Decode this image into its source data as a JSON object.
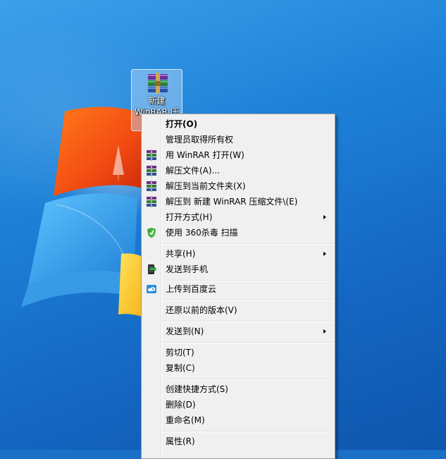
{
  "desktop_icon": {
    "label": "新建\nWinRAR 压",
    "icon": "winrar-archive-icon"
  },
  "context_menu": {
    "items": [
      {
        "label": "打开(O)",
        "bold": true,
        "icon": "",
        "submenu": false
      },
      {
        "label": "管理员取得所有权",
        "icon": "",
        "submenu": false
      },
      {
        "label": "用 WinRAR 打开(W)",
        "icon": "winrar-icon",
        "submenu": false
      },
      {
        "label": "解压文件(A)...",
        "icon": "winrar-icon",
        "submenu": false
      },
      {
        "label": "解压到当前文件夹(X)",
        "icon": "winrar-icon",
        "submenu": false
      },
      {
        "label": "解压到 新建 WinRAR 压缩文件\\(E)",
        "icon": "winrar-icon",
        "submenu": false
      },
      {
        "label": "打开方式(H)",
        "icon": "",
        "submenu": true
      },
      {
        "label": "使用 360杀毒 扫描",
        "icon": "360-shield-icon",
        "submenu": false
      },
      {
        "label": "共享(H)",
        "icon": "",
        "submenu": true
      },
      {
        "label": "发送到手机",
        "icon": "send-to-phone-icon",
        "submenu": false
      },
      {
        "label": "上传到百度云",
        "icon": "baidu-cloud-icon",
        "submenu": false
      },
      {
        "label": "还原以前的版本(V)",
        "icon": "",
        "submenu": false
      },
      {
        "label": "发送到(N)",
        "icon": "",
        "submenu": true
      },
      {
        "label": "剪切(T)",
        "icon": "",
        "submenu": false
      },
      {
        "label": "复制(C)",
        "icon": "",
        "submenu": false
      },
      {
        "label": "创建快捷方式(S)",
        "icon": "",
        "submenu": false
      },
      {
        "label": "删除(D)",
        "icon": "",
        "submenu": false
      },
      {
        "label": "重命名(M)",
        "icon": "",
        "submenu": false
      },
      {
        "label": "属性(R)",
        "icon": "",
        "submenu": false
      }
    ]
  },
  "colors": {
    "desktop_blue": "#1e82d8",
    "menu_bg": "#f0f0f0",
    "menu_border": "#979797"
  }
}
